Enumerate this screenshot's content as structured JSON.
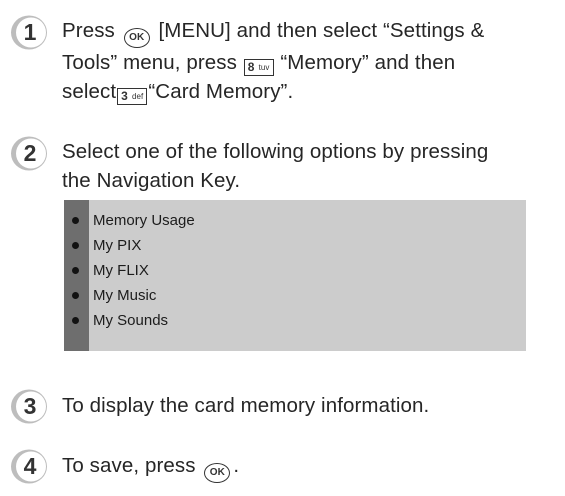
{
  "step1": {
    "number": "1",
    "press": "Press",
    "ok_key": "OK",
    "text_a": "[MENU] and then select “Settings &",
    "text_b": "Tools” menu, press",
    "key8_digit": "8",
    "key8_letters": "tuv",
    "text_c": "“Memory” and then",
    "text_d": "select",
    "key3_digit": "3",
    "key3_letters": "def",
    "text_e": "“Card Memory”."
  },
  "step2": {
    "number": "2",
    "line1": "Select one of the following options by pressing",
    "line2": "the Navigation Key."
  },
  "options": [
    "Memory Usage",
    "My PIX",
    "My FLIX",
    "My Music",
    "My Sounds"
  ],
  "step3": {
    "number": "3",
    "text": "To display the card memory information."
  },
  "step4": {
    "number": "4",
    "text": "To save, press",
    "ok_key": "OK",
    "end": "."
  },
  "colors": {
    "badge_fill": "#333333",
    "badge_ring": "#bdbdbd",
    "options_bg": "#cccccc",
    "options_bar": "#6e6e6e"
  }
}
